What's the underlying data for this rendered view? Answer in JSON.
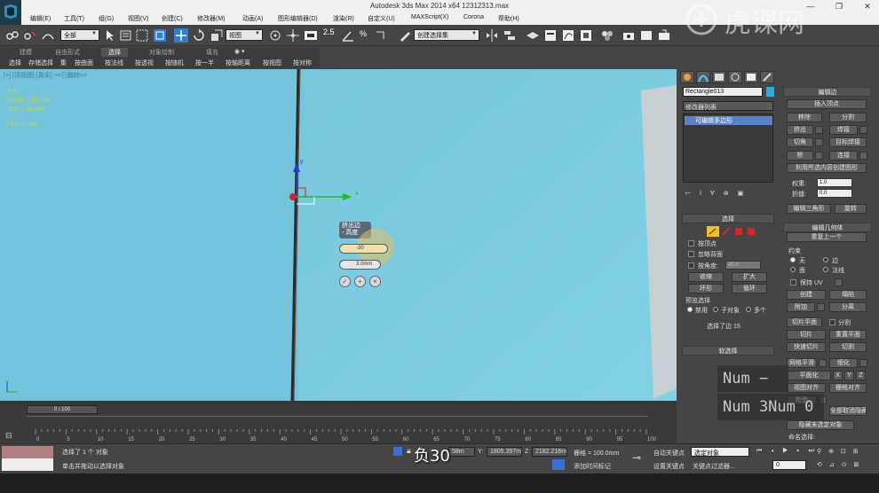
{
  "window": {
    "title": "Autodesk 3ds Max  2014 x64      12312313.max",
    "minimize": "—",
    "restore": "❐",
    "close": "✕"
  },
  "menu": [
    "编辑(E)",
    "工具(T)",
    "组(G)",
    "视图(V)",
    "创建(C)",
    "修改器(M)",
    "动画(A)",
    "图形编辑器(D)",
    "渲染(R)",
    "自定义(U)",
    "MAXScript(X)",
    "Corona",
    "帮助(H)"
  ],
  "toolbar": {
    "filter_value": "全部",
    "refcoord_value": "视图",
    "selset_value": "创建选择集",
    "snap_label": "2.5"
  },
  "ribbon": {
    "tabs": [
      "建模",
      "自由形式",
      "选择",
      "对象绘制",
      "填充"
    ],
    "active_tab": "选择",
    "items": [
      "选择",
      "存储选择",
      "集",
      "按曲面",
      "按法线",
      "按透视",
      "按随机",
      "按一半",
      "按轴距离",
      "按视图",
      "按对称"
    ]
  },
  "viewport": {
    "label": "[+] [顶视图] [真实] <<已翻转>>",
    "stats": [
      "总计",
      "多边形: 4,357,445",
      "顶点: 2,189,989",
      "FPS: 36.394"
    ],
    "axis_y": "y",
    "axis_x": "x",
    "colors": {
      "bg": "#7dcbe0",
      "gizmo_x": "#22bb22",
      "gizmo_y": "#1f3bd8",
      "gizmo_z": "#d22"
    }
  },
  "caddy": {
    "title_line1": "挤出边",
    "title_line2": "- 高度",
    "height_value": "-30",
    "width_value": "3.0mm",
    "ok": "✓",
    "apply": "+",
    "cancel": "×"
  },
  "command_panel": {
    "object_name": "Rectangle013",
    "modifier_list": "修改器列表",
    "stack_item": "可编辑多边形",
    "edit_edges": {
      "title": "编辑边",
      "insert_vertex": "插入顶点",
      "remove": "移除",
      "split": "分割",
      "extrude": "挤出",
      "weld": "焊接",
      "chamfer": "切角",
      "target_weld": "目标焊接",
      "bridge": "桥",
      "connect": "连接",
      "create_shape": "利用所选内容创建图形",
      "weight_label": "权重:",
      "weight_value": "1.0",
      "crease_label": "折缝:",
      "crease_value": "0.0",
      "edit_tri": "编辑三角形",
      "turn": "旋转"
    },
    "selection": {
      "title": "选择",
      "by_vertex": "按顶点",
      "ignore_backface": "忽略背面",
      "by_angle": "按角度:",
      "angle_value": "45.0",
      "shrink": "收缩",
      "grow": "扩大",
      "ring": "环形",
      "loop": "循环",
      "preview_title": "预览选择",
      "preview_off": "禁用",
      "preview_sub": "子对象",
      "preview_multi": "多个",
      "status": "选择了边 15",
      "soft_selection": "软选择"
    },
    "edit_geometry": {
      "title": "编辑几何体",
      "repeat_last": "重复上一个",
      "constraints": "约束",
      "c_none": "无",
      "c_edge": "边",
      "c_face": "面",
      "c_normal": "法线",
      "preserve_uv": "保持 UV",
      "create": "创建",
      "collapse": "塌陷",
      "attach": "附加",
      "detach": "分离",
      "slice_plane": "切片平面",
      "split": "分割",
      "slice": "切片",
      "reset_plane": "重置平面",
      "quickslice": "快速切片",
      "cut": "切割",
      "meshsmooth": "网格平滑",
      "tessellate": "细化",
      "planarize": "平面化",
      "x": "X",
      "y": "Y",
      "z": "Z",
      "view_align": "视图对齐",
      "grid_align": "栅格对齐",
      "relax": "松弛",
      "hide_sel": "隐藏选定对象",
      "unhide_all": "全部取消隐藏",
      "hide_unsel": "隐藏未选定对象",
      "named_sel": "命名选择:"
    }
  },
  "numpad": [
    "Num −",
    "Num 3Num 0"
  ],
  "timeline": {
    "frame": "0 / 100",
    "ticks": [
      "0",
      "5",
      "10",
      "15",
      "20",
      "25",
      "30",
      "35",
      "40",
      "45",
      "50",
      "55",
      "60",
      "65",
      "70",
      "75",
      "80",
      "85",
      "90",
      "95",
      "100"
    ]
  },
  "status": {
    "selected": "选择了 1 个 对象",
    "prompt": "单击并拖动以选择对象",
    "x_value": "58m",
    "y_label": "Y:",
    "y_value": "1805.397m",
    "z_label": "Z:",
    "z_value": "2182.216m",
    "grid": "栅格 = 100.0mm",
    "add_time_tag": "添加时间标记",
    "autokey": "自动关键点",
    "selected_obj": "选定对象",
    "set_key": "设置关键点",
    "key_filters": "关键点过滤器...",
    "frame_value": "0"
  },
  "subtitle": "负30",
  "watermark": "虎课网"
}
